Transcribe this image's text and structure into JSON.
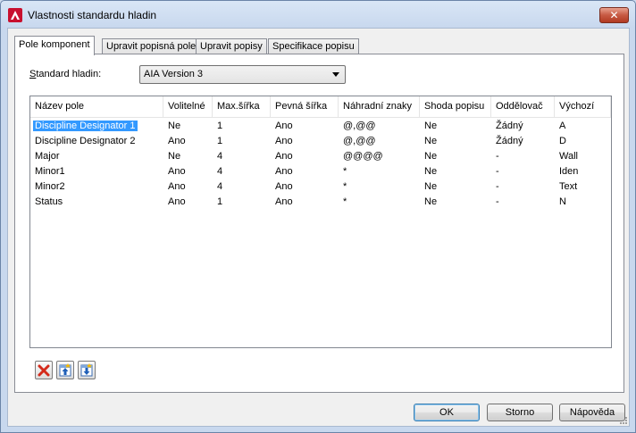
{
  "window": {
    "title": "Vlastnosti standardu hladin",
    "close_label": "✕"
  },
  "tabs": [
    {
      "label": "Pole komponent"
    },
    {
      "label": "Upravit popisná pole"
    },
    {
      "label": "Upravit popisy"
    },
    {
      "label": "Specifikace popisu"
    }
  ],
  "standard": {
    "label_prefix": "S",
    "label_rest": "tandard hladin:",
    "value": "AIA Version 3"
  },
  "table": {
    "columns": [
      "Název pole",
      "Volitelné",
      "Max.šířka",
      "Pevná šířka",
      "Náhradní znaky",
      "Shoda popisu",
      "Oddělovač",
      "Výchozí"
    ],
    "rows": [
      [
        "Discipline Designator 1",
        "Ne",
        "1",
        "Ano",
        "@,@@",
        "Ne",
        "Žádný",
        "A"
      ],
      [
        "Discipline Designator 2",
        "Ano",
        "1",
        "Ano",
        "@,@@",
        "Ne",
        "Žádný",
        "D"
      ],
      [
        "Major",
        "Ne",
        "4",
        "Ano",
        "@@@@",
        "Ne",
        "-",
        "Wall"
      ],
      [
        "Minor1",
        "Ano",
        "4",
        "Ano",
        "*",
        "Ne",
        "-",
        "Iden"
      ],
      [
        "Minor2",
        "Ano",
        "4",
        "Ano",
        "*",
        "Ne",
        "-",
        "Text"
      ],
      [
        "Status",
        "Ano",
        "1",
        "Ano",
        "*",
        "Ne",
        "-",
        "N"
      ]
    ]
  },
  "buttons": {
    "ok": "OK",
    "cancel": "Storno",
    "help": "Nápověda"
  },
  "icons": {
    "delete": "delete-icon",
    "move_up": "move-up-icon",
    "move_down": "move-down-icon"
  }
}
